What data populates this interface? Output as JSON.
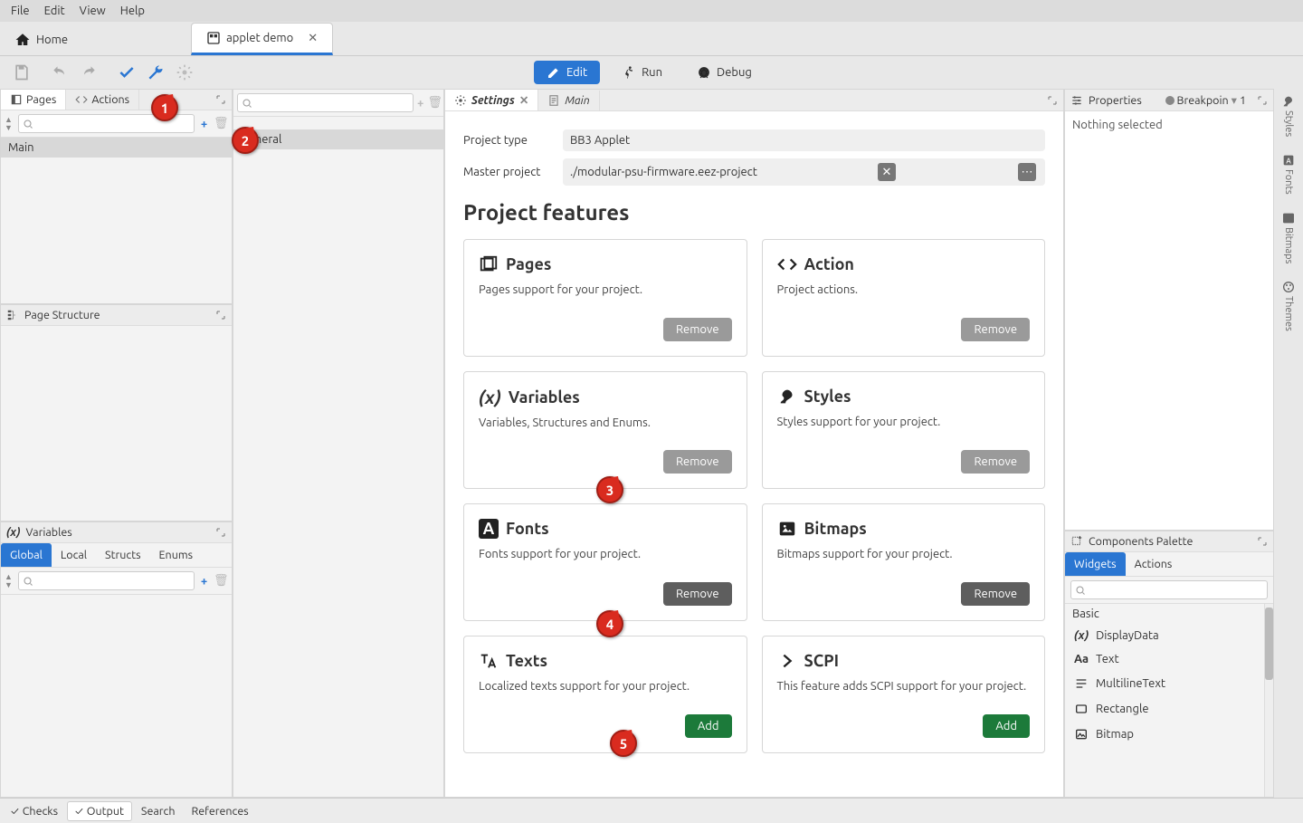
{
  "menu": {
    "file": "File",
    "edit": "Edit",
    "view": "View",
    "help": "Help"
  },
  "tabs": {
    "home": "Home",
    "doc": "applet demo"
  },
  "modes": {
    "edit": "Edit",
    "run": "Run",
    "debug": "Debug"
  },
  "left": {
    "pages_label": "Pages",
    "actions_label": "Actions",
    "main_item": "Main",
    "page_structure": "Page Structure",
    "variables": "Variables",
    "var_tabs": {
      "global": "Global",
      "local": "Local",
      "structs": "Structs",
      "enums": "Enums"
    }
  },
  "mid": {
    "tab_settings": "Settings",
    "tab_main": "Main",
    "settings_item": "General",
    "form": {
      "project_type_label": "Project type",
      "project_type_value": "BB3 Applet",
      "master_label": "Master project",
      "master_value": "./modular-psu-firmware.eez-project"
    },
    "section_title": "Project features",
    "features": [
      {
        "title": "Pages",
        "desc": "Pages support for your project.",
        "action": "remove"
      },
      {
        "title": "Action",
        "desc": "Project actions.",
        "action": "remove"
      },
      {
        "title": "Variables",
        "desc": "Variables, Structures and Enums.",
        "action": "remove"
      },
      {
        "title": "Styles",
        "desc": "Styles support for your project.",
        "action": "remove"
      },
      {
        "title": "Fonts",
        "desc": "Fonts support for your project.",
        "action": "remove-dark"
      },
      {
        "title": "Bitmaps",
        "desc": "Bitmaps support for your project.",
        "action": "remove-dark"
      },
      {
        "title": "Texts",
        "desc": "Localized texts support for your project.",
        "action": "add"
      },
      {
        "title": "SCPI",
        "desc": "This feature adds SCPI support for your project.",
        "action": "add"
      }
    ],
    "btn_remove": "Remove",
    "btn_add": "Add"
  },
  "right": {
    "properties": "Properties",
    "breakpoints": "Breakpoin",
    "bp_count": "1",
    "nothing_selected": "Nothing selected",
    "palette": "Components Palette",
    "palette_tabs": {
      "widgets": "Widgets",
      "actions": "Actions"
    },
    "palette_section": "Basic",
    "palette_items": {
      "displaydata": "DisplayData",
      "text": "Text",
      "multiline": "MultilineText",
      "rectangle": "Rectangle",
      "bitmap": "Bitmap"
    }
  },
  "dock": {
    "styles": "Styles",
    "fonts": "Fonts",
    "bitmaps": "Bitmaps",
    "themes": "Themes"
  },
  "bottom": {
    "checks": "Checks",
    "output": "Output",
    "search": "Search",
    "references": "References"
  },
  "badges": {
    "b1": "1",
    "b2": "2",
    "b3": "3",
    "b4": "4",
    "b5": "5"
  }
}
